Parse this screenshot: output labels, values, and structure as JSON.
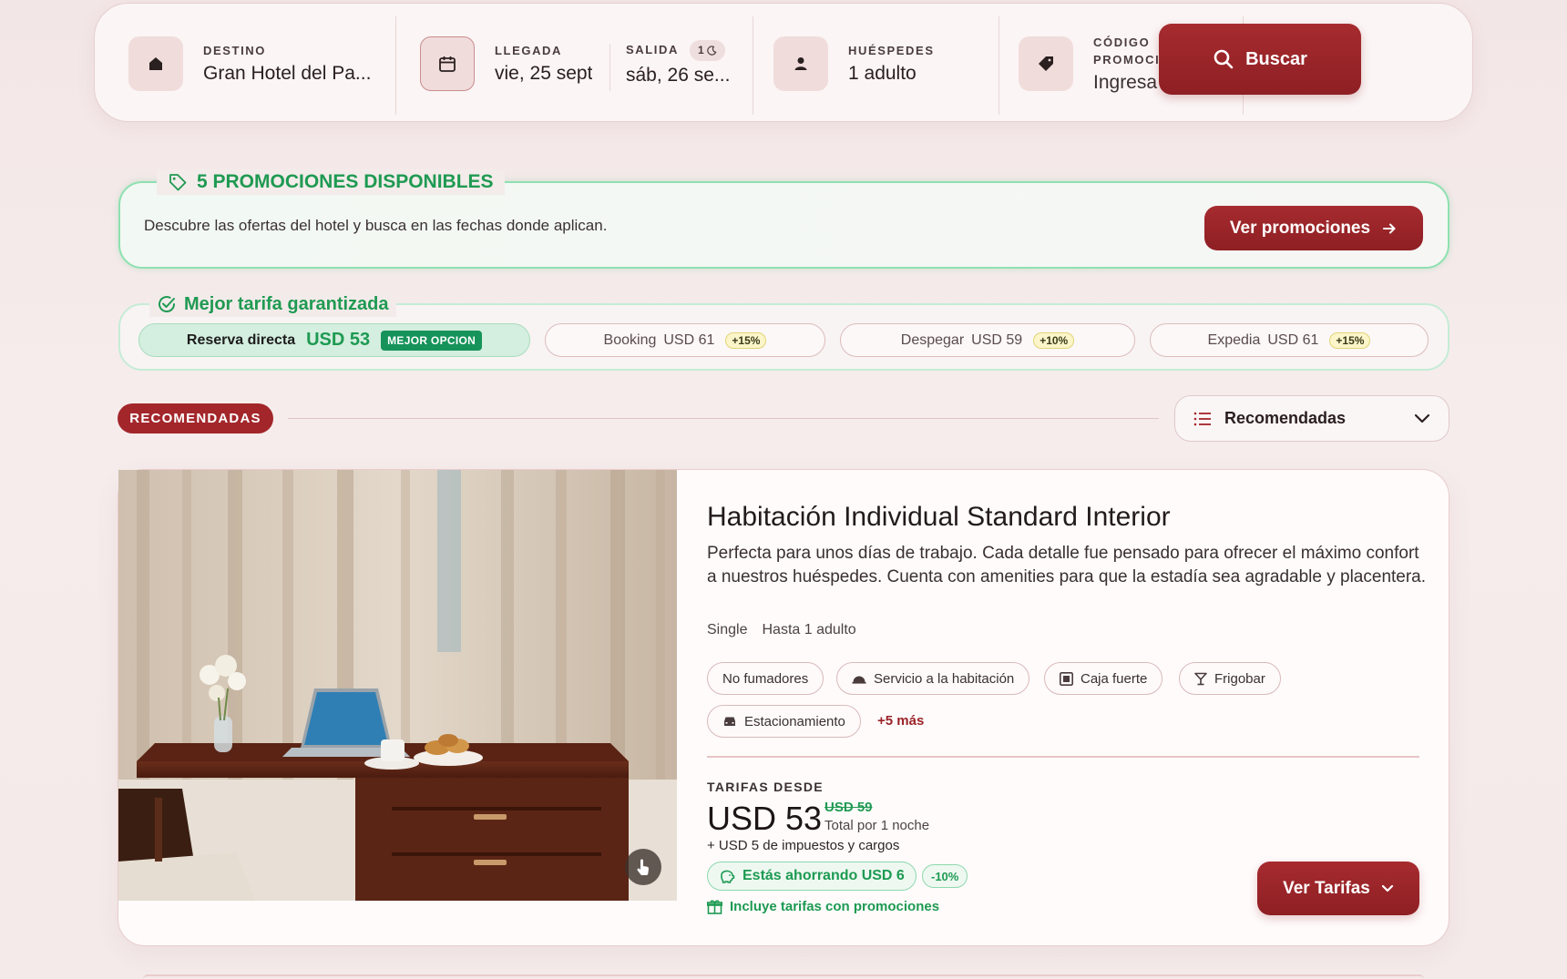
{
  "search": {
    "destination": {
      "label": "DESTINO",
      "value": "Gran Hotel del Pa..."
    },
    "arrival": {
      "label": "LLEGADA",
      "value": "vie, 25 sept"
    },
    "departure": {
      "label": "SALIDA",
      "value": "sáb, 26 se...",
      "nights": "1"
    },
    "guests": {
      "label": "HUÉSPEDES",
      "value": "1 adulto"
    },
    "promo_code": {
      "label_line1": "CÓDIGO",
      "label_line2": "PROMOCIONAL",
      "placeholder": "Ingresa tu có..."
    },
    "button_label": "Buscar"
  },
  "promotions": {
    "title": "5 PROMOCIONES DISPONIBLES",
    "description": "Descubre las ofertas del hotel y busca en las fechas donde aplican.",
    "button_label": "Ver promociones"
  },
  "best_rate": {
    "title": "Mejor tarifa garantizada",
    "direct": {
      "label": "Reserva directa",
      "price": "USD 53",
      "badge": "MEJOR OPCION"
    },
    "competitors": [
      {
        "name": "Booking",
        "price": "USD 61",
        "diff": "+15%"
      },
      {
        "name": "Despegar",
        "price": "USD 59",
        "diff": "+10%"
      },
      {
        "name": "Expedia",
        "price": "USD 61",
        "diff": "+15%"
      }
    ]
  },
  "listing": {
    "badge": "RECOMENDADAS",
    "sort_label": "Recomendadas"
  },
  "room": {
    "title": "Habitación Individual Standard Interior",
    "description": "Perfecta para unos días de trabajo. Cada detalle fue pensado para ofrecer el máximo confort a nuestros huéspedes. Cuenta con amenities para que la estadía sea agradable y placentera.",
    "type": "Single",
    "capacity": "Hasta 1 adulto",
    "amenities": [
      "No fumadores",
      "Servicio a la habitación",
      "Caja fuerte",
      "Frigobar",
      "Estacionamiento"
    ],
    "more_amenities": "+5 más",
    "rates_label": "TARIFAS DESDE",
    "price": "USD 53",
    "old_price": "USD 59",
    "price_note": "Total por 1 noche",
    "taxes": "+ USD 5 de impuestos y cargos",
    "saving": "Estás ahorrando USD 6",
    "saving_pct": "-10%",
    "promo_note": "Incluye tarifas con promociones",
    "button_label": "Ver Tarifas"
  },
  "colors": {
    "brand_red": "#a3262b",
    "success_green": "#1f9a52",
    "background": "#f4e8e8"
  }
}
